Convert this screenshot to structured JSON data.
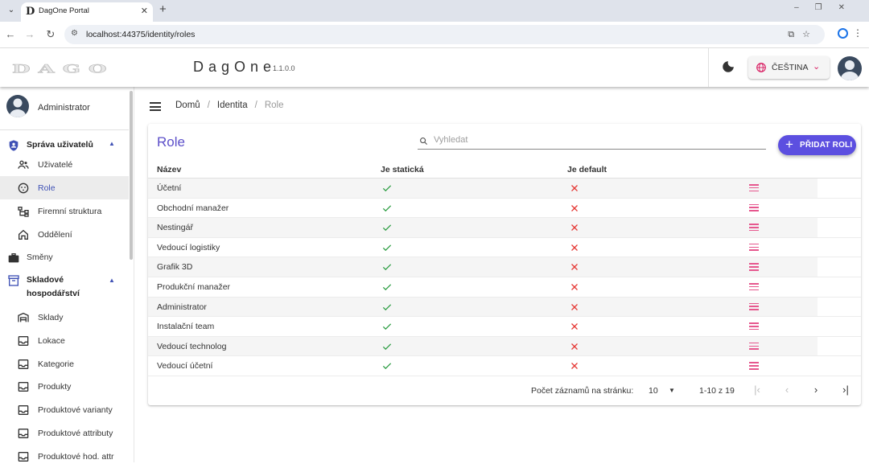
{
  "browser": {
    "tab_title": "DagOne Portal",
    "url": "localhost:44375/identity/roles"
  },
  "header": {
    "logo_text": "DAGO",
    "app_name": "DagOne",
    "version": "1.1.0.0",
    "language_label": "ČEŠTINA"
  },
  "sidebar": {
    "user_name": "Administrator",
    "group_users": "Správa uživatelů",
    "users_items": [
      {
        "label": "Uživatelé",
        "icon": "people-icon"
      },
      {
        "label": "Role",
        "icon": "face-icon"
      },
      {
        "label": "Firemní struktura",
        "icon": "hierarchy-icon"
      },
      {
        "label": "Oddělení",
        "icon": "home-icon"
      }
    ],
    "shifts": "Směny",
    "group_warehouse_1": "Skladové",
    "group_warehouse_2": "hospodářství",
    "warehouse_items": [
      {
        "label": "Sklady",
        "icon": "warehouse-icon"
      },
      {
        "label": "Lokace",
        "icon": "inbox-icon"
      },
      {
        "label": "Kategorie",
        "icon": "inbox-icon"
      },
      {
        "label": "Produkty",
        "icon": "inbox-icon"
      },
      {
        "label": "Produktové varianty",
        "icon": "inbox-icon"
      },
      {
        "label": "Produktové attributy",
        "icon": "inbox-icon"
      },
      {
        "label": "Produktové hod. attr",
        "icon": "inbox-icon"
      }
    ]
  },
  "breadcrumb": {
    "home": "Domů",
    "section": "Identita",
    "current": "Role"
  },
  "roles_card": {
    "title": "Role",
    "search_placeholder": "Vyhledat",
    "add_button": "PŘIDAT ROLI",
    "columns": [
      "Název",
      "Je statická",
      "Je default"
    ],
    "rows": [
      {
        "name": "Účetní",
        "is_static": true,
        "is_default": false
      },
      {
        "name": "Obchodní manažer",
        "is_static": true,
        "is_default": false
      },
      {
        "name": "Nestingář",
        "is_static": true,
        "is_default": false
      },
      {
        "name": "Vedoucí logistiky",
        "is_static": true,
        "is_default": false
      },
      {
        "name": "Grafik 3D",
        "is_static": true,
        "is_default": false
      },
      {
        "name": "Produkční manažer",
        "is_static": true,
        "is_default": false
      },
      {
        "name": "Administrator",
        "is_static": true,
        "is_default": false
      },
      {
        "name": "Instalační team",
        "is_static": true,
        "is_default": false
      },
      {
        "name": "Vedoucí technolog",
        "is_static": true,
        "is_default": false
      },
      {
        "name": "Vedoucí účetní",
        "is_static": true,
        "is_default": false
      }
    ]
  },
  "pagination": {
    "page_size_label": "Počet záznamů na stránku:",
    "page_size": "10",
    "range": "1-10 z 19"
  },
  "colors": {
    "accent": "#5c4fe0",
    "check": "#2e9e44",
    "cross": "#e53935",
    "row_menu": "#e6578e"
  }
}
